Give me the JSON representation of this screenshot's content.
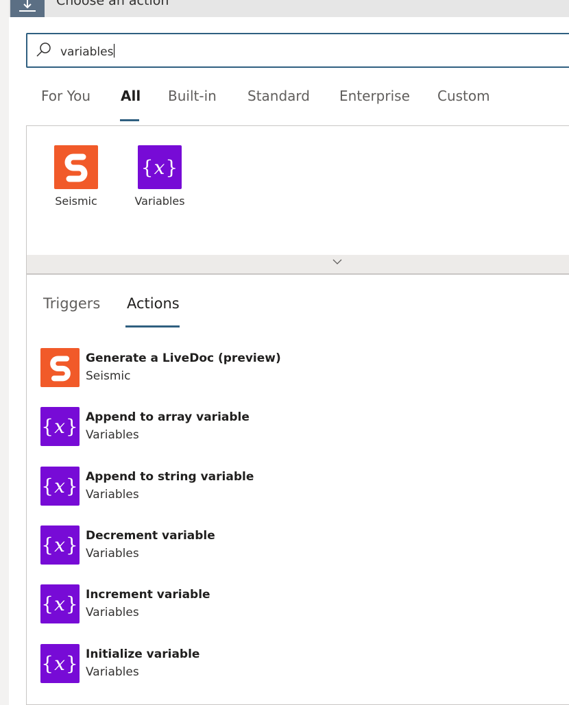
{
  "header": {
    "title": "Choose an action"
  },
  "search": {
    "value": "variables"
  },
  "tabs": [
    {
      "label": "For You"
    },
    {
      "label": "All"
    },
    {
      "label": "Built-in"
    },
    {
      "label": "Standard"
    },
    {
      "label": "Enterprise"
    },
    {
      "label": "Custom"
    }
  ],
  "active_tab": "All",
  "connectors": [
    {
      "label": "Seismic",
      "icon": "seismic-icon",
      "color": "#f15a29"
    },
    {
      "label": "Variables",
      "icon": "variables-icon",
      "color": "#770bd6"
    }
  ],
  "subtabs": [
    {
      "label": "Triggers"
    },
    {
      "label": "Actions"
    }
  ],
  "active_subtab": "Actions",
  "actions": [
    {
      "title": "Generate a LiveDoc (preview)",
      "connector": "Seismic",
      "icon": "seismic-icon"
    },
    {
      "title": "Append to array variable",
      "connector": "Variables",
      "icon": "variables-icon"
    },
    {
      "title": "Append to string variable",
      "connector": "Variables",
      "icon": "variables-icon"
    },
    {
      "title": "Decrement variable",
      "connector": "Variables",
      "icon": "variables-icon"
    },
    {
      "title": "Increment variable",
      "connector": "Variables",
      "icon": "variables-icon"
    },
    {
      "title": "Initialize variable",
      "connector": "Variables",
      "icon": "variables-icon"
    }
  ],
  "colors": {
    "accent": "#2f5f80",
    "seismic": "#f15a29",
    "variables": "#770bd6",
    "header_icon_bg": "#5b6f84"
  }
}
